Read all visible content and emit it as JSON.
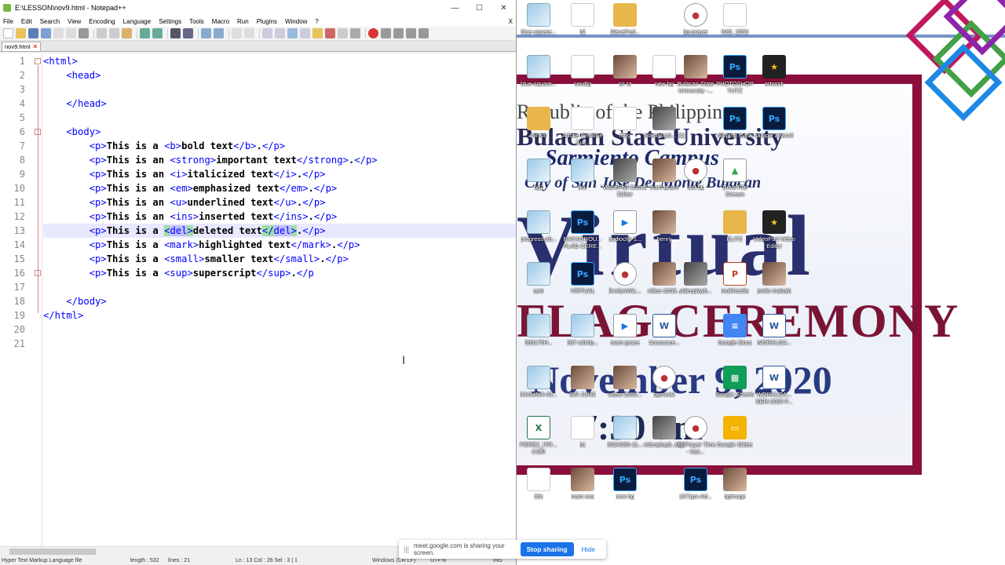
{
  "window": {
    "title": "E:\\LESSON\\nov9.html - Notepad++",
    "minimize": "—",
    "maximize": "☐",
    "close": "✕"
  },
  "menu": [
    "File",
    "Edit",
    "Search",
    "View",
    "Encoding",
    "Language",
    "Settings",
    "Tools",
    "Macro",
    "Run",
    "Plugins",
    "Window",
    "?"
  ],
  "menu_close": "X",
  "tab": {
    "label": "nov9.html",
    "close": "✕"
  },
  "editor": {
    "line_numbers": [
      "1",
      "2",
      "3",
      "4",
      "5",
      "6",
      "7",
      "8",
      "9",
      "10",
      "11",
      "12",
      "13",
      "14",
      "15",
      "16",
      "17",
      "18",
      "19",
      "20",
      "21"
    ],
    "current_line": 13
  },
  "status": {
    "file_type": "Hyper Text Markup Language file",
    "length": "length : 532",
    "lines": "lines : 21",
    "position": "Ln : 13    Col : 26    Sel : 3 | 1",
    "eol": "Windows (CR LF)",
    "encoding": "UTF-8",
    "mode": "INS"
  },
  "share_bar": {
    "grip": "|||",
    "message": "meet.google.com is sharing your screen.",
    "stop": "Stop sharing",
    "hide": "Hide"
  },
  "wallpaper": {
    "line1": "Republic of the Philippines",
    "line2": "Bulacan State University",
    "line3": "Sarmiento Campus",
    "line4": "City of San Jose Del Monte Bulacan",
    "line5": "Virtual",
    "line6": "FLAG CEREMONY",
    "line7": "November 9, 2020",
    "line8": "7:30 am"
  },
  "desktop_icons": [
    {
      "label": "blue-square...",
      "type": "img"
    },
    {
      "label": "b2",
      "type": "blank"
    },
    {
      "label": "WavePad...",
      "type": "folder"
    },
    {
      "label": "bg-prayer",
      "type": "rec"
    },
    {
      "label": "IMG_3050",
      "type": "blank"
    },
    {
      "label": "blue-square...",
      "type": "img"
    },
    {
      "label": "newBg",
      "type": "blank"
    },
    {
      "label": "sir ra",
      "type": "photo"
    },
    {
      "label": "new bg",
      "type": "blank"
    },
    {
      "label": "Bulacan State University -...",
      "type": "photo"
    },
    {
      "label": "PHOTOSHOP TUTZ",
      "type": "ps"
    },
    {
      "label": "artwork",
      "type": "star"
    },
    {
      "label": "minion",
      "type": "folder"
    },
    {
      "label": "Adobe Creative Sui...",
      "type": "blank"
    },
    {
      "label": "mbg",
      "type": "blank"
    },
    {
      "label": "videoplayb... (1)",
      "type": "vid"
    },
    {
      "label": "clipping mask",
      "type": "ps"
    },
    {
      "label": "sample artwork",
      "type": "ps"
    },
    {
      "label": "bg2",
      "type": "img"
    },
    {
      "label": "bsu",
      "type": "img"
    },
    {
      "label": "WavePad Sound Editor",
      "type": "vid"
    },
    {
      "label": "mam grace",
      "type": "photo"
    },
    {
      "label": "last bg",
      "type": "rec"
    },
    {
      "label": "Drive File Stream",
      "type": "drive"
    },
    {
      "label": "progress-ab...",
      "type": "img"
    },
    {
      "label": "BACKGROU... FLAG CERE...",
      "type": "ps"
    },
    {
      "label": "audioclip-1...",
      "type": "doc"
    },
    {
      "label": "henry",
      "type": "photo"
    },
    {
      "label": "ELITS",
      "type": "folder"
    },
    {
      "label": "VideoPad Video Editor",
      "type": "star"
    },
    {
      "label": "sam",
      "type": "img"
    },
    {
      "label": "VIRTUAL",
      "type": "ps"
    },
    {
      "label": "EvelynVAL...",
      "type": "rec"
    },
    {
      "label": "video-1603...",
      "type": "photo"
    },
    {
      "label": "videoplayb...",
      "type": "vid"
    },
    {
      "label": "multimedia",
      "type": "ppt"
    },
    {
      "label": "jonilo mabalo",
      "type": "photo"
    },
    {
      "label": "659175H...",
      "type": "img"
    },
    {
      "label": "887-whirlp...",
      "type": "img"
    },
    {
      "label": "mam grace",
      "type": "doc"
    },
    {
      "label": "Announce...",
      "type": "word"
    },
    {
      "label": "Google Docs",
      "type": "gdoc"
    },
    {
      "label": "WORKLOA...",
      "type": "word"
    },
    {
      "label": "84c945f4-49...",
      "type": "img"
    },
    {
      "label": "SIR JUNS",
      "type": "photo"
    },
    {
      "label": "video-1603...",
      "type": "photo"
    },
    {
      "label": "bgmusic",
      "type": "rec"
    },
    {
      "label": "Google Sheets",
      "type": "gsheet"
    },
    {
      "label": "WORKLOA... SEM 2020 F...",
      "type": "word"
    },
    {
      "label": "PEREZ_ITR... COR",
      "type": "xl"
    },
    {
      "label": "b1",
      "type": "blank"
    },
    {
      "label": "8824656-11...",
      "type": "img"
    },
    {
      "label": "videoplayb... (1)",
      "type": "vid"
    },
    {
      "label": "My Prayer Time - lost...",
      "type": "rec"
    },
    {
      "label": "Google Slides",
      "type": "gslide"
    },
    {
      "label": "title",
      "type": "blank"
    },
    {
      "label": "mam eva",
      "type": "photo"
    },
    {
      "label": "new bg",
      "type": "ps"
    },
    {
      "label": "1071px-Ad...",
      "type": "ps"
    },
    {
      "label": "bgimage",
      "type": "photo"
    }
  ]
}
